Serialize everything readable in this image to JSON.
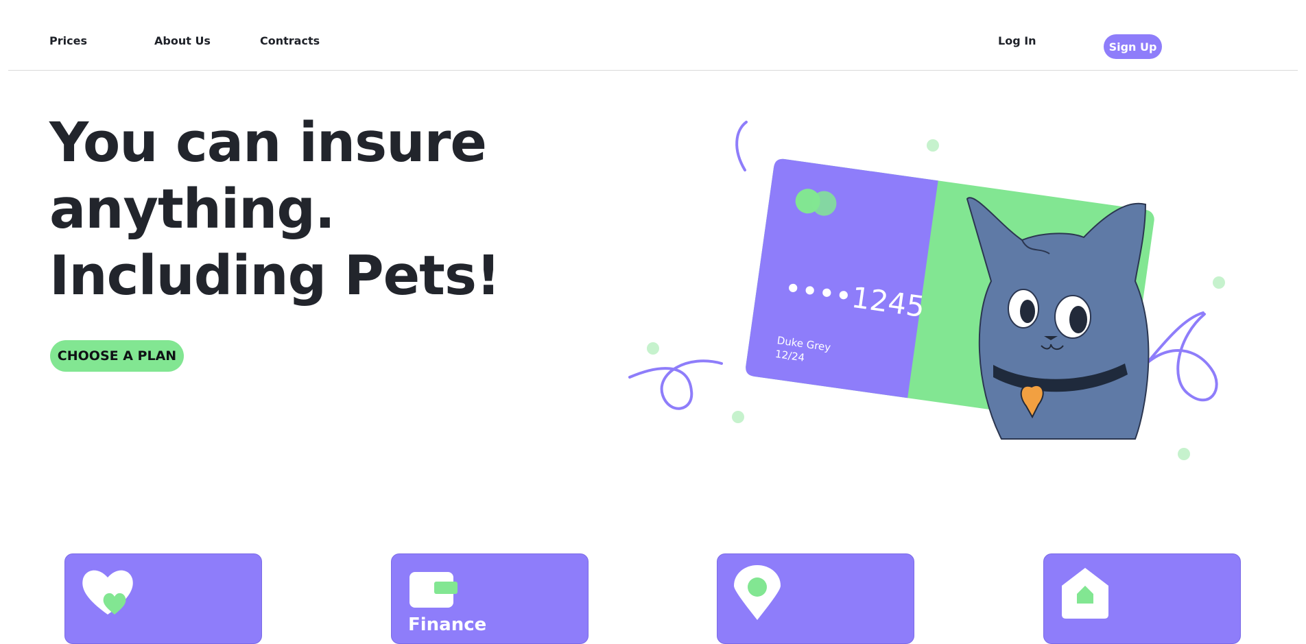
{
  "nav": {
    "links": [
      "Prices",
      "About Us",
      "Contracts"
    ],
    "login_label": "Log In",
    "signup_label": "Sign Up"
  },
  "hero": {
    "title_lines": [
      "You can insure",
      "anything.",
      "Including Pets!"
    ],
    "cta_label": "CHOOSE A PLAN"
  },
  "card": {
    "number": "••••1245",
    "holder": "Duke Grey",
    "expiry": "12/24"
  },
  "features": [
    {
      "icon": "heart-icon",
      "label": ""
    },
    {
      "icon": "wallet-icon",
      "label": "Finance"
    },
    {
      "icon": "location-pin-icon",
      "label": ""
    },
    {
      "icon": "house-icon",
      "label": ""
    }
  ],
  "colors": {
    "accent_purple": "#8e7dfa",
    "accent_green": "#82e692",
    "text_dark": "#22252c",
    "cat_blue": "#5f7aa6"
  }
}
